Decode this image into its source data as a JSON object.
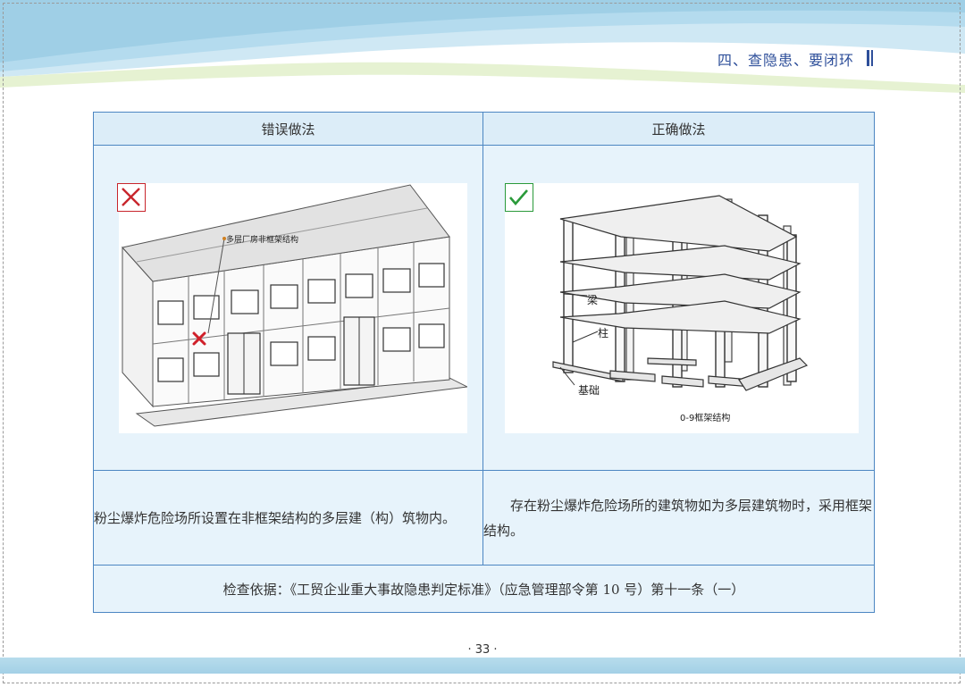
{
  "header": {
    "section_title": "四、查隐患、要闭环"
  },
  "table": {
    "col_wrong_header": "错误做法",
    "col_right_header": "正确做法",
    "wrong_image": {
      "mark_icon": "red-cross-icon",
      "label_callout": "多层厂房非框架结构"
    },
    "right_image": {
      "mark_icon": "green-check-icon",
      "label_beam": "梁",
      "label_column": "柱",
      "label_foundation": "基础",
      "caption": "0-9框架结构"
    },
    "wrong_description": "粉尘爆炸危险场所设置在非框架结构的多层建（构）筑物内。",
    "right_description": "存在粉尘爆炸危险场所的建筑物如为多层建筑物时，采用框架结构。",
    "basis": "检查依据：《工贸企业重大事故隐患判定标准》（应急管理部令第 10 号）第十一条（一）"
  },
  "footer": {
    "page_number": "· 33 ·"
  },
  "colors": {
    "accent": "#2e4f9a",
    "border": "#4c86c2",
    "cell_bg": "#e7f3fb",
    "wrong": "#c8252c",
    "right": "#2a9a3a"
  }
}
